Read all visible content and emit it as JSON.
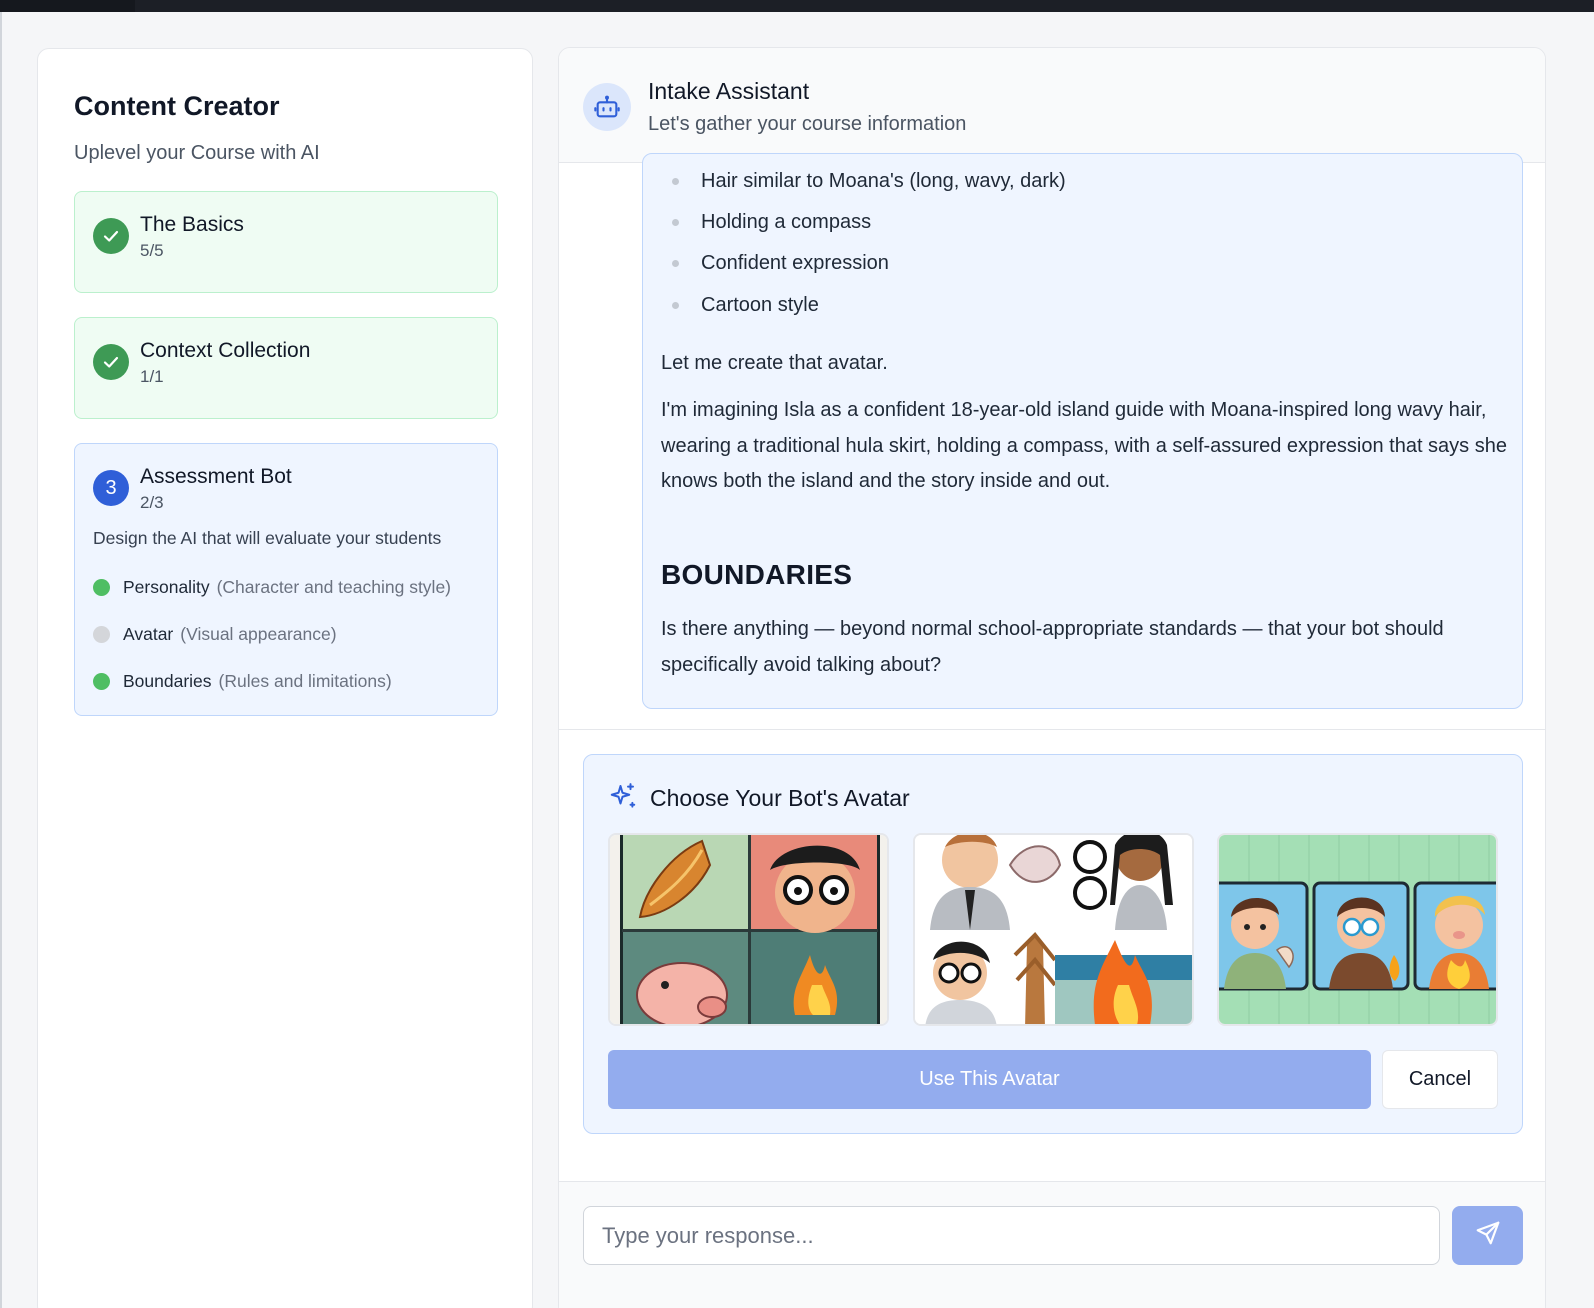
{
  "sidebar": {
    "title": "Content Creator",
    "subtitle": "Uplevel your Course with AI",
    "steps": [
      {
        "name": "The Basics",
        "count": "5/5",
        "status": "complete"
      },
      {
        "name": "Context Collection",
        "count": "1/1",
        "status": "complete"
      },
      {
        "number": "3",
        "name": "Assessment Bot",
        "count": "2/3",
        "status": "active",
        "description": "Design the AI that will evaluate your students",
        "items": [
          {
            "name": "Personality",
            "note": "(Character and teaching style)",
            "status": "complete"
          },
          {
            "name": "Avatar",
            "note": "(Visual appearance)",
            "status": "pending"
          },
          {
            "name": "Boundaries",
            "note": "(Rules and limitations)",
            "status": "complete"
          }
        ]
      }
    ]
  },
  "chat": {
    "header": {
      "title": "Intake Assistant",
      "subtitle": "Let's gather your course information",
      "icon": "robot-icon"
    },
    "message": {
      "bullets": [
        "Hair similar to Moana's (long, wavy, dark)",
        "Holding a compass",
        "Confident expression",
        "Cartoon style"
      ],
      "para1": "Let me create that avatar.",
      "para2": "I'm imagining Isla as a confident 18-year-old island guide with Moana-inspired long wavy hair, wearing a traditional hula skirt, holding a compass, with a self-assured expression that says she knows both the island and the story inside and out.",
      "heading": "BOUNDARIES",
      "para3": "Is there anything — beyond normal school-appropriate standards — that your bot should specifically avoid talking about?"
    },
    "avatar_picker": {
      "title": "Choose Your Bot's Avatar",
      "icon": "sparkles-icon",
      "options": [
        "avatar-option-1",
        "avatar-option-2",
        "avatar-option-3"
      ],
      "use_label": "Use This Avatar",
      "cancel_label": "Cancel"
    },
    "input": {
      "placeholder": "Type your response...",
      "send_icon": "send-icon"
    }
  },
  "colors": {
    "accent": "#2f5fd8",
    "complete": "#3e9a55",
    "button_disabled": "#93acee"
  }
}
